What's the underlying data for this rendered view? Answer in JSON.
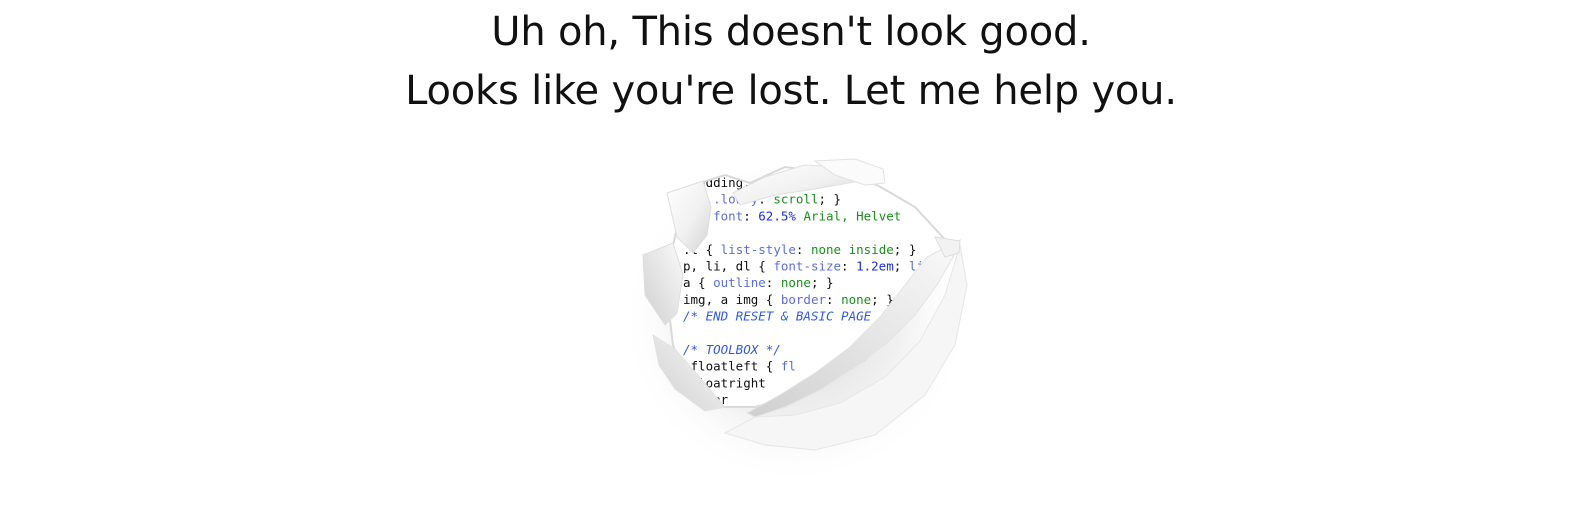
{
  "headline": {
    "line1": "Uh oh, This doesn't look good.",
    "line2": "Looks like you're lost. Let me help you."
  },
  "illustration": {
    "icon": "torn-paper-hole-icon",
    "colors": {
      "keyword": "#5b6fd6",
      "value": "#1a8f1a",
      "number": "#1a2fd6",
      "comment": "#2d5be0",
      "plain": "#111111"
    },
    "code_lines": [
      [
        {
          "t": "..adding: 0; }",
          "c": "plain"
        }
      ],
      [
        {
          "t": "   ..low-y",
          "c": "keyword"
        },
        {
          "t": ": ",
          "c": "plain"
        },
        {
          "t": "scroll",
          "c": "value"
        },
        {
          "t": "; }",
          "c": "plain"
        }
      ],
      [
        {
          "t": "  { ",
          "c": "plain"
        },
        {
          "t": "font",
          "c": "keyword"
        },
        {
          "t": ": ",
          "c": "plain"
        },
        {
          "t": "62.5%",
          "c": "number"
        },
        {
          "t": " ",
          "c": "plain"
        },
        {
          "t": "Arial, Helvet",
          "c": "value"
        }
      ],
      [
        {
          "t": "",
          "c": "plain"
        }
      ],
      [
        {
          "t": ".l { ",
          "c": "plain"
        },
        {
          "t": "list-style",
          "c": "keyword"
        },
        {
          "t": ": ",
          "c": "plain"
        },
        {
          "t": "none inside",
          "c": "value"
        },
        {
          "t": "; }",
          "c": "plain"
        }
      ],
      [
        {
          "t": "p, li, dl { ",
          "c": "plain"
        },
        {
          "t": "font-size",
          "c": "keyword"
        },
        {
          "t": ": ",
          "c": "plain"
        },
        {
          "t": "1.2em",
          "c": "number"
        },
        {
          "t": "; ",
          "c": "plain"
        },
        {
          "t": "line-",
          "c": "keyword"
        }
      ],
      [
        {
          "t": "a { ",
          "c": "plain"
        },
        {
          "t": "outline",
          "c": "keyword"
        },
        {
          "t": ": ",
          "c": "plain"
        },
        {
          "t": "none",
          "c": "value"
        },
        {
          "t": "; }",
          "c": "plain"
        }
      ],
      [
        {
          "t": "img, a img { ",
          "c": "plain"
        },
        {
          "t": "border",
          "c": "keyword"
        },
        {
          "t": ": ",
          "c": "plain"
        },
        {
          "t": "none",
          "c": "value"
        },
        {
          "t": "; }",
          "c": "plain"
        }
      ],
      [
        {
          "t": "/* END RESET & BASIC PAGE",
          "c": "comment"
        }
      ],
      [
        {
          "t": "",
          "c": "plain"
        }
      ],
      [
        {
          "t": "/* TOOLBOX */",
          "c": "comment"
        }
      ],
      [
        {
          "t": ".floatleft { ",
          "c": "plain"
        },
        {
          "t": "fl",
          "c": "keyword"
        }
      ],
      [
        {
          "t": ".floatright",
          "c": "plain"
        }
      ],
      [
        {
          "t": " .cear",
          "c": "plain"
        }
      ]
    ]
  }
}
